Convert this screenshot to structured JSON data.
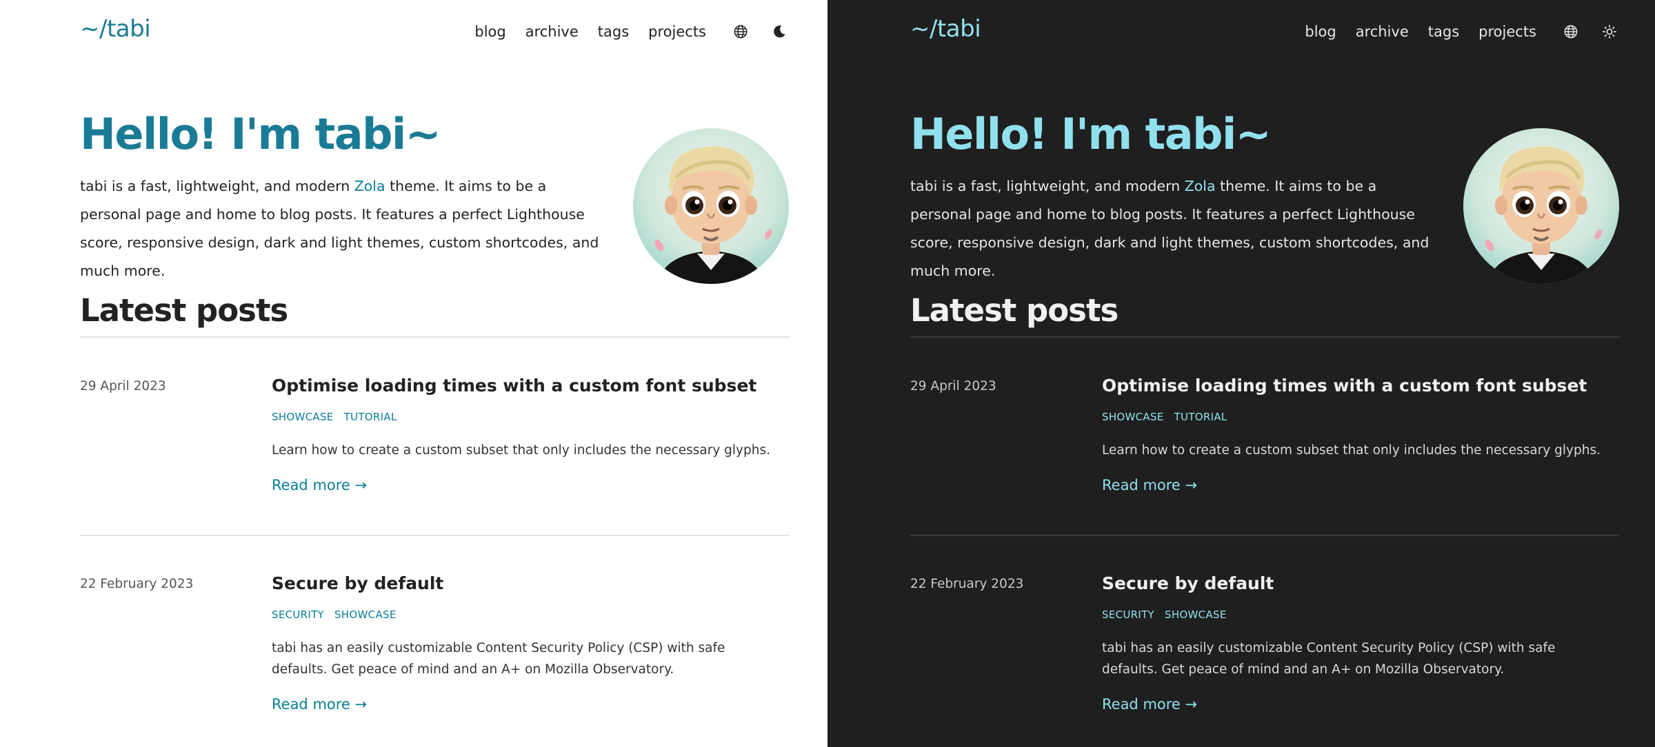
{
  "site": {
    "logo": "~/tabi",
    "nav": [
      "blog",
      "archive",
      "tags",
      "projects"
    ],
    "icons": {
      "language": "globe-icon",
      "theme_light_mode": "moon-icon",
      "theme_dark_mode": "sun-icon"
    }
  },
  "hero": {
    "title": "Hello! I'm tabi~",
    "text_before_link": "tabi is a fast, lightweight, and modern ",
    "link_text": "Zola",
    "text_after_link": " theme. It aims to be a personal page and home to blog posts. It features a perfect Lighthouse score, responsive design, dark and light themes, custom shortcodes, and much more."
  },
  "latest_heading": "Latest posts",
  "posts": [
    {
      "date": "29 April 2023",
      "title": "Optimise loading times with a custom font subset",
      "tags": [
        "SHOWCASE",
        "TUTORIAL"
      ],
      "description": "Learn how to create a custom subset that only includes the necessary glyphs.",
      "read_more": "Read more →"
    },
    {
      "date": "22 February 2023",
      "title": "Secure by default",
      "tags": [
        "SECURITY",
        "SHOWCASE"
      ],
      "description": "tabi has an easily customizable Content Security Policy (CSP) with safe defaults. Get peace of mind and an A+ on Mozilla Observatory.",
      "read_more": "Read more →"
    }
  ],
  "colors": {
    "light_accent": "#087e96",
    "dark_accent": "#91e0ee",
    "dark_background": "#1f1f1f"
  }
}
